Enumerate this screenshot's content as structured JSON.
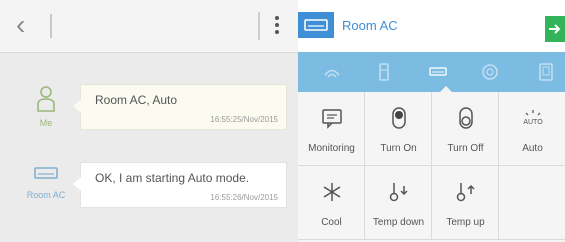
{
  "chat": {
    "messages": [
      {
        "sender": "Me",
        "text": "Room AC, Auto",
        "time": "16:55:25/Nov/2015"
      },
      {
        "sender": "Room AC",
        "text": "OK, I am starting Auto mode.",
        "time": "16:55:26/Nov/2015"
      }
    ]
  },
  "device": {
    "title": "Room AC",
    "accent": "#3e8fd6",
    "strip_color": "#7cbbe2",
    "send_color": "#32b55a"
  },
  "controls": [
    {
      "label": "Monitoring",
      "icon": "monitor-icon"
    },
    {
      "label": "Turn On",
      "icon": "power-on-icon"
    },
    {
      "label": "Turn Off",
      "icon": "power-off-icon"
    },
    {
      "label": "Auto",
      "icon": "auto-mode-icon"
    },
    {
      "label": "Cool",
      "icon": "snowflake-icon"
    },
    {
      "label": "Temp down",
      "icon": "temp-down-icon"
    },
    {
      "label": "Temp up",
      "icon": "temp-up-icon"
    }
  ]
}
